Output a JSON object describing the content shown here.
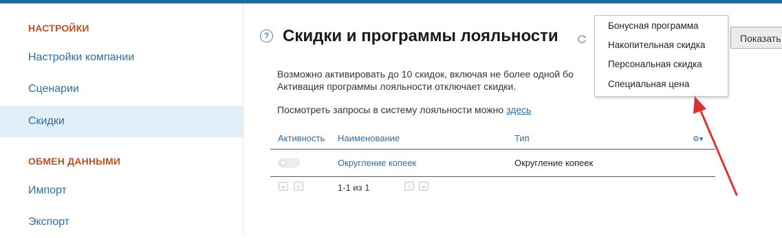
{
  "sidebar": {
    "settings_title": "НАСТРОЙКИ",
    "settings_items": [
      {
        "label": "Настройки компании"
      },
      {
        "label": "Сценарии"
      },
      {
        "label": "Скидки"
      }
    ],
    "exchange_title": "ОБМЕН ДАННЫМИ",
    "exchange_items": [
      {
        "label": "Импорт"
      },
      {
        "label": "Экспорт"
      }
    ]
  },
  "header": {
    "help": "?",
    "title": "Скидки и программы лояльности",
    "show_button": "Показать"
  },
  "description": {
    "line1": "Возможно активировать до 10 скидок, включая не более одной бо",
    "line2": "Активация программы лояльности отключает скидки.",
    "line3_prefix": "Посмотреть запросы в систему лояльности можно ",
    "line3_link": "здесь"
  },
  "table": {
    "headers": {
      "active": "Активность",
      "name": "Наименование",
      "type": "Тип"
    },
    "rows": [
      {
        "name": "Округление копеек",
        "type": "Округление копеек",
        "active": false
      }
    ],
    "pager": {
      "info": "1-1 из 1",
      "first": "«",
      "prev": "‹",
      "next": "›",
      "last": "»"
    }
  },
  "dropdown": {
    "items": [
      {
        "label": "Бонусная программа"
      },
      {
        "label": "Накопительная скидка"
      },
      {
        "label": "Персональная скидка"
      },
      {
        "label": "Специальная цена"
      }
    ]
  },
  "colors": {
    "accent": "#1f6b9b",
    "link": "#2a6ea6",
    "section": "#c0501e",
    "arrow": "#e0322d"
  }
}
